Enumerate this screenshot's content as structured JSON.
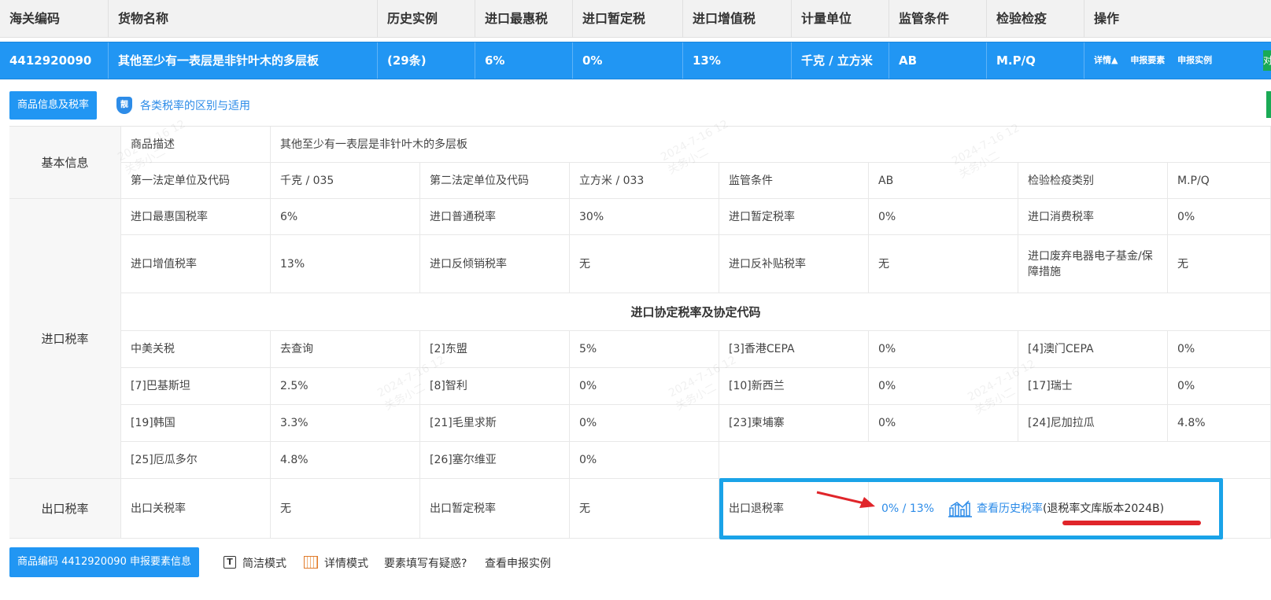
{
  "header": {
    "cols": [
      "海关编码",
      "货物名称",
      "历史实例",
      "进口最惠税",
      "进口暂定税",
      "进口增值税",
      "计量单位",
      "监管条件",
      "检验检疫",
      "操作"
    ]
  },
  "selected_row": {
    "code": "4412920090",
    "name": "其他至少有一表层是非针叶木的多层板",
    "history": "(29条)",
    "mfn": "6%",
    "provisional": "0%",
    "vat": "13%",
    "unit": "千克 / 立方米",
    "supervision": "AB",
    "inspection": "M.P/Q",
    "ops": [
      "详情▲",
      "申报要素",
      "申报实例"
    ],
    "stub": "对"
  },
  "tabs": {
    "goods_info_button": "商品信息及税率",
    "shield_glyph": "靓",
    "rate_link": "各类税率的区别与适用"
  },
  "basic": {
    "section": "基本信息",
    "desc_label": "商品描述",
    "desc_value": "其他至少有一表层是非针叶木的多层板",
    "unit1_label": "第一法定单位及代码",
    "unit1_value": "千克 / 035",
    "unit2_label": "第二法定单位及代码",
    "unit2_value": "立方米 / 033",
    "supervision_label": "监管条件",
    "supervision_value": "AB",
    "inspection_label": "检验检疫类别",
    "inspection_value": "M.P/Q"
  },
  "import": {
    "section": "进口税率",
    "rows": [
      [
        [
          "进口最惠国税率",
          "6%"
        ],
        [
          "进口普通税率",
          "30%"
        ],
        [
          "进口暂定税率",
          "0%"
        ],
        [
          "进口消费税率",
          "0%"
        ]
      ],
      [
        [
          "进口增值税率",
          "13%"
        ],
        [
          "进口反倾销税率",
          "无"
        ],
        [
          "进口反补贴税率",
          "无"
        ],
        [
          "进口废弃电器电子基金/保障措施",
          "无"
        ]
      ]
    ],
    "agreement_title": "进口协定税率及协定代码",
    "agreements": [
      [
        [
          "中美关税",
          "去查询"
        ],
        [
          "[2]东盟",
          "5%"
        ],
        [
          "[3]香港CEPA",
          "0%"
        ],
        [
          "[4]澳门CEPA",
          "0%"
        ]
      ],
      [
        [
          "[7]巴基斯坦",
          "2.5%"
        ],
        [
          "[8]智利",
          "0%"
        ],
        [
          "[10]新西兰",
          "0%"
        ],
        [
          "[17]瑞士",
          "0%"
        ]
      ],
      [
        [
          "[19]韩国",
          "3.3%"
        ],
        [
          "[21]毛里求斯",
          "0%"
        ],
        [
          "[23]柬埔寨",
          "0%"
        ],
        [
          "[24]尼加拉瓜",
          "4.8%"
        ]
      ],
      [
        [
          "[25]厄瓜多尔",
          "4.8%"
        ],
        [
          "[26]塞尔维亚",
          "0%"
        ]
      ]
    ]
  },
  "export": {
    "section": "出口税率",
    "tariff_label": "出口关税率",
    "tariff_value": "无",
    "provisional_label": "出口暂定税率",
    "provisional_value": "无",
    "rebate_label": "出口退税率",
    "rebate_value": "0% / 13%",
    "history_link": "查看历史税率",
    "library_note": "(退税率文库版本2024B)"
  },
  "watermark": {
    "date": "2024-7-16 12",
    "user": "关务小二"
  },
  "bottom": {
    "declare_button": "商品编码 4412920090 申报要素信息",
    "simple_glyph": "T",
    "simple_mode": "简洁模式",
    "detail_mode": "详情模式",
    "question": "要素填写有疑惑?",
    "example_link": "查看申报实例"
  },
  "colors": {
    "primary": "#2196f3",
    "link": "#2d8ce8",
    "highlight_box": "#1aa3e8",
    "annotation_red": "#e0252a"
  }
}
